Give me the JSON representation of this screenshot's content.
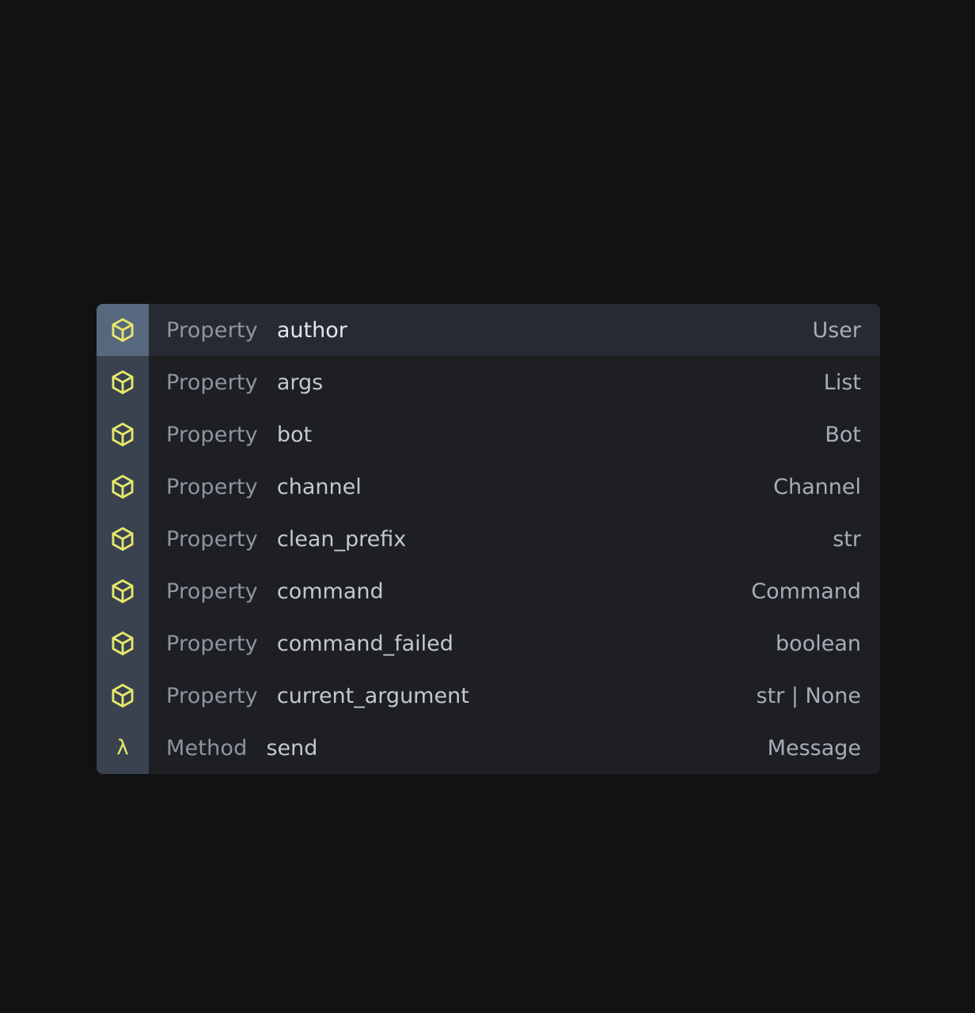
{
  "colors": {
    "background": "#111214",
    "popup": "#1e1f22",
    "selected_row": "#262a32",
    "icon_column": "#3a4250",
    "icon_column_selected": "#57677d",
    "icon_accent": "#e7e86b"
  },
  "completion": {
    "items": [
      {
        "icon": "cube-icon",
        "kind": "Property",
        "name": "author",
        "type": "User",
        "selected": true
      },
      {
        "icon": "cube-icon",
        "kind": "Property",
        "name": "args",
        "type": "List",
        "selected": false
      },
      {
        "icon": "cube-icon",
        "kind": "Property",
        "name": "bot",
        "type": "Bot",
        "selected": false
      },
      {
        "icon": "cube-icon",
        "kind": "Property",
        "name": "channel",
        "type": "Channel",
        "selected": false
      },
      {
        "icon": "cube-icon",
        "kind": "Property",
        "name": "clean_prefix",
        "type": "str",
        "selected": false
      },
      {
        "icon": "cube-icon",
        "kind": "Property",
        "name": "command",
        "type": "Command",
        "selected": false
      },
      {
        "icon": "cube-icon",
        "kind": "Property",
        "name": "command_failed",
        "type": "boolean",
        "selected": false
      },
      {
        "icon": "cube-icon",
        "kind": "Property",
        "name": "current_argument",
        "type": "str | None",
        "selected": false
      },
      {
        "icon": "lambda-icon",
        "icon_glyph": "λ",
        "kind": "Method",
        "name": "send",
        "type": "Message",
        "selected": false
      }
    ]
  }
}
